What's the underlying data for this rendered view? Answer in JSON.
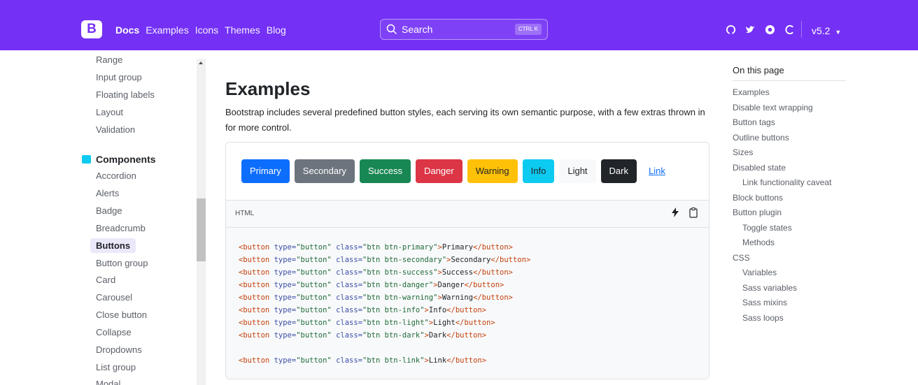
{
  "navbar": {
    "logo": "B",
    "links": [
      "Docs",
      "Examples",
      "Icons",
      "Themes",
      "Blog"
    ],
    "search_label": "Search",
    "search_shortcut": "CTRL K",
    "version": "v5.2"
  },
  "sidebar": {
    "top_items": [
      "Range",
      "Input group",
      "Floating labels",
      "Layout",
      "Validation"
    ],
    "group_label": "Components",
    "items": [
      "Accordion",
      "Alerts",
      "Badge",
      "Breadcrumb",
      "Buttons",
      "Button group",
      "Card",
      "Carousel",
      "Close button",
      "Collapse",
      "Dropdowns",
      "List group",
      "Modal"
    ],
    "active_item": "Buttons"
  },
  "main": {
    "title": "Examples",
    "lead": "Bootstrap includes several predefined button styles, each serving its own semantic purpose, with a few extras thrown in for more control.",
    "buttons": [
      {
        "label": "Primary",
        "color": "#0d6efd"
      },
      {
        "label": "Secondary",
        "color": "#6c757d"
      },
      {
        "label": "Success",
        "color": "#198754"
      },
      {
        "label": "Danger",
        "color": "#dc3545"
      },
      {
        "label": "Warning",
        "color": "#ffc107"
      },
      {
        "label": "Info",
        "color": "#0dcaf0"
      },
      {
        "label": "Light",
        "color": "#f8f9fa"
      },
      {
        "label": "Dark",
        "color": "#212529"
      },
      {
        "label": "Link",
        "color": "#0d6efd"
      }
    ],
    "code_lang": "HTML",
    "code_lines": [
      {
        "cls": "btn btn-primary",
        "text": "Primary"
      },
      {
        "cls": "btn btn-secondary",
        "text": "Secondary"
      },
      {
        "cls": "btn btn-success",
        "text": "Success"
      },
      {
        "cls": "btn btn-danger",
        "text": "Danger"
      },
      {
        "cls": "btn btn-warning",
        "text": "Warning"
      },
      {
        "cls": "btn btn-info",
        "text": "Info"
      },
      {
        "cls": "btn btn-light",
        "text": "Light"
      },
      {
        "cls": "btn btn-dark",
        "text": "Dark"
      },
      {
        "cls": "btn btn-link",
        "text": "Link"
      }
    ]
  },
  "toc": {
    "heading": "On this page",
    "items": [
      {
        "label": "Examples",
        "indent": false
      },
      {
        "label": "Disable text wrapping",
        "indent": false
      },
      {
        "label": "Button tags",
        "indent": false
      },
      {
        "label": "Outline buttons",
        "indent": false
      },
      {
        "label": "Sizes",
        "indent": false
      },
      {
        "label": "Disabled state",
        "indent": false
      },
      {
        "label": "Link functionality caveat",
        "indent": true
      },
      {
        "label": "Block buttons",
        "indent": false
      },
      {
        "label": "Button plugin",
        "indent": false
      },
      {
        "label": "Toggle states",
        "indent": true
      },
      {
        "label": "Methods",
        "indent": true
      },
      {
        "label": "CSS",
        "indent": false
      },
      {
        "label": "Variables",
        "indent": true
      },
      {
        "label": "Sass variables",
        "indent": true
      },
      {
        "label": "Sass mixins",
        "indent": true
      },
      {
        "label": "Sass loops",
        "indent": true
      }
    ]
  },
  "icons": [
    "github-icon",
    "twitter-icon",
    "opencollective-icon",
    "spinner-icon",
    "lightning-icon",
    "clipboard-icon",
    "search-icon",
    "bootstrap-logo-icon",
    "components-icon"
  ]
}
